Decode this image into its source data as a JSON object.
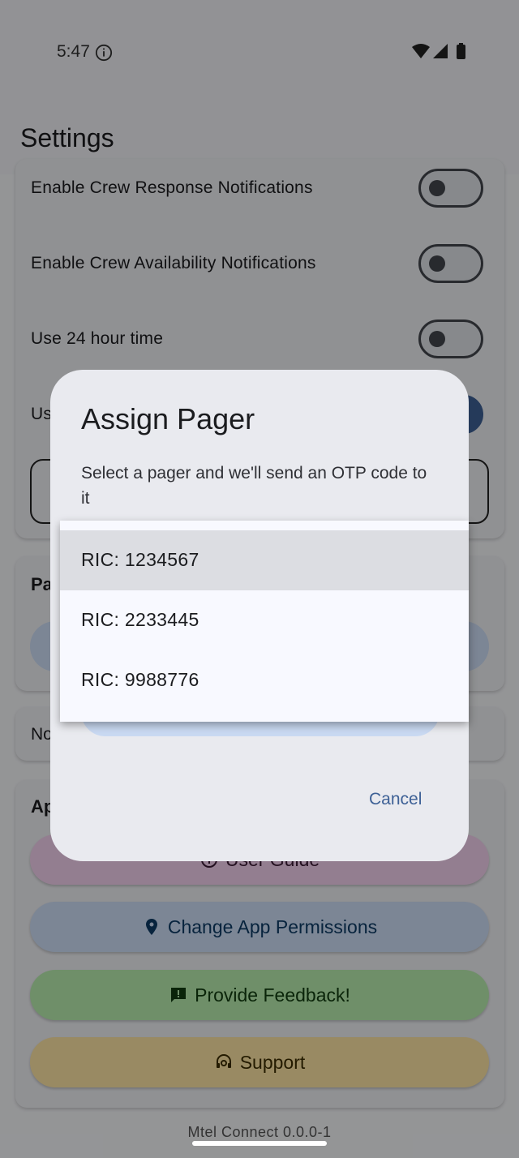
{
  "status_bar": {
    "time": "5:47"
  },
  "app_bar": {
    "title": "Settings"
  },
  "settings": [
    {
      "label": "Enable Crew Response Notifications",
      "on": false
    },
    {
      "label": "Enable Crew Availability Notifications",
      "on": false
    },
    {
      "label": "Use 24 hour time",
      "on": false
    },
    {
      "label": "Us",
      "on": true
    }
  ],
  "pager_section": {
    "heading": "Pa"
  },
  "notes_section": {
    "text": "No"
  },
  "app_section": {
    "heading": "Ap",
    "buttons": [
      {
        "label": "User Guide",
        "icon": "info-icon",
        "bg": "#f6d2f0",
        "color": "#3b1b36"
      },
      {
        "label": "Change App Permissions",
        "icon": "location-pin-icon",
        "bg": "#cfe0f8",
        "color": "#0d3b66"
      },
      {
        "label": "Provide Feedback!",
        "icon": "feedback-icon",
        "bg": "#b9efb0",
        "color": "#123d10"
      },
      {
        "label": "Support",
        "icon": "support-agent-icon",
        "bg": "#ffe7a6",
        "color": "#3d2d00"
      }
    ]
  },
  "dialog": {
    "title": "Assign Pager",
    "body": "Select a pager and we'll send an OTP code to it",
    "cancel_label": "Cancel"
  },
  "dropdown": {
    "items": [
      {
        "label": "RIC: 1234567",
        "selected": true
      },
      {
        "label": "RIC: 2233445",
        "selected": false
      },
      {
        "label": "RIC: 9988776",
        "selected": false
      }
    ]
  },
  "footer": {
    "version": "Mtel Connect 0.0.0-1"
  }
}
